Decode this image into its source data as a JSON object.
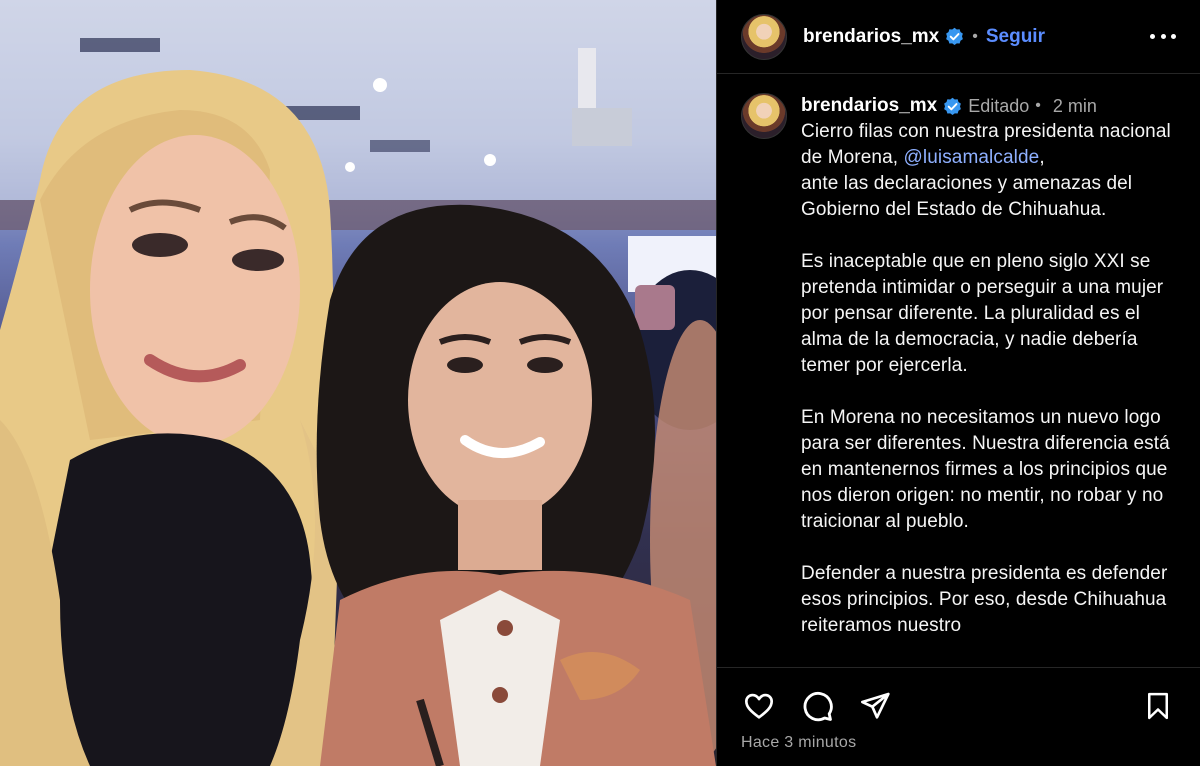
{
  "post": {
    "username": "brendarios_mx",
    "follow_label": "Seguir",
    "separator": "•",
    "edited_label": "Editado",
    "time_ago": "2 min",
    "caption_pre": "Cierro filas con nuestra presidenta nacional de Morena, ",
    "mention": "@luisamalcalde",
    "caption_post": ",\nante las declaraciones y amenazas del Gobierno del Estado de Chihuahua.\n\nEs inaceptable que en pleno siglo XXI se pretenda intimidar o perseguir a una mujer por pensar diferente. La pluralidad es el alma de la democracia, y nadie debería temer por ejercerla.\n\nEn Morena no necesitamos un nuevo logo para ser diferentes. Nuestra diferencia está en mantenernos firmes a los principios que nos dieron origen: no mentir, no robar y no traicionar al pueblo.\n\nDefender a nuestra presidenta es defender esos principios. Por eso, desde Chihuahua reiteramos nuestro",
    "timestamp": "Hace 3 minutos"
  },
  "icons": {
    "verified": "verified-badge-icon",
    "more": "more-options-icon",
    "like": "heart-icon",
    "comment": "comment-icon",
    "share": "share-icon",
    "save": "bookmark-icon"
  },
  "colors": {
    "background": "#000000",
    "follow": "#5b8dff",
    "mention": "#8fb0ff",
    "muted": "#a8a8a8",
    "verified": "#3897f0"
  }
}
